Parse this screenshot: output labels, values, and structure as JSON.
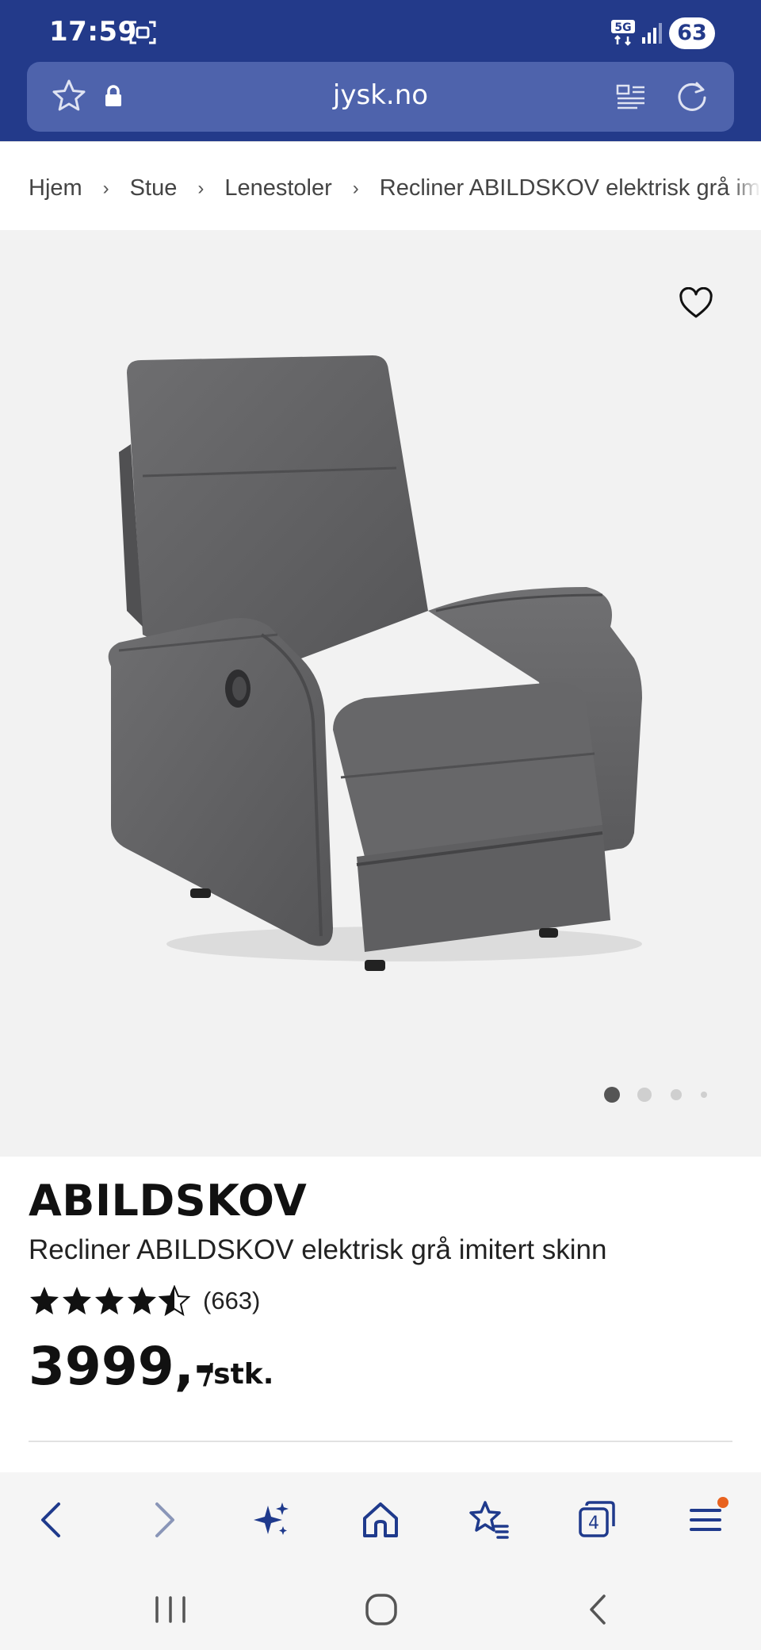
{
  "status_bar": {
    "time": "17:59",
    "network": "5G",
    "battery": "63"
  },
  "browser": {
    "url": "jysk.no",
    "tab_count": "4"
  },
  "breadcrumb": {
    "items": [
      "Hjem",
      "Stue",
      "Lenestoler",
      "Recliner ABILDSKOV elektrisk grå imitert skinn"
    ]
  },
  "gallery": {
    "image_count": 4,
    "active_index": 0
  },
  "product": {
    "brand": "ABILDSKOV",
    "name": "Recliner ABILDSKOV elektrisk grå imitert skinn",
    "rating": 4.5,
    "rating_count": "(663)",
    "price": "3999,-",
    "unit": "/stk."
  },
  "icons": {
    "toolbar": [
      "back-icon",
      "forward-icon",
      "sparkle-icon",
      "home-icon",
      "bookmarks-icon",
      "tabs-icon",
      "menu-icon"
    ],
    "system_nav": [
      "recents-icon",
      "home-circle-icon",
      "system-back-icon"
    ]
  },
  "colors": {
    "brand_bar": "#233a8a",
    "url_bar": "#4e63ac",
    "toolbar_accent": "#1f3a8c",
    "notification_dot": "#e8621f"
  }
}
